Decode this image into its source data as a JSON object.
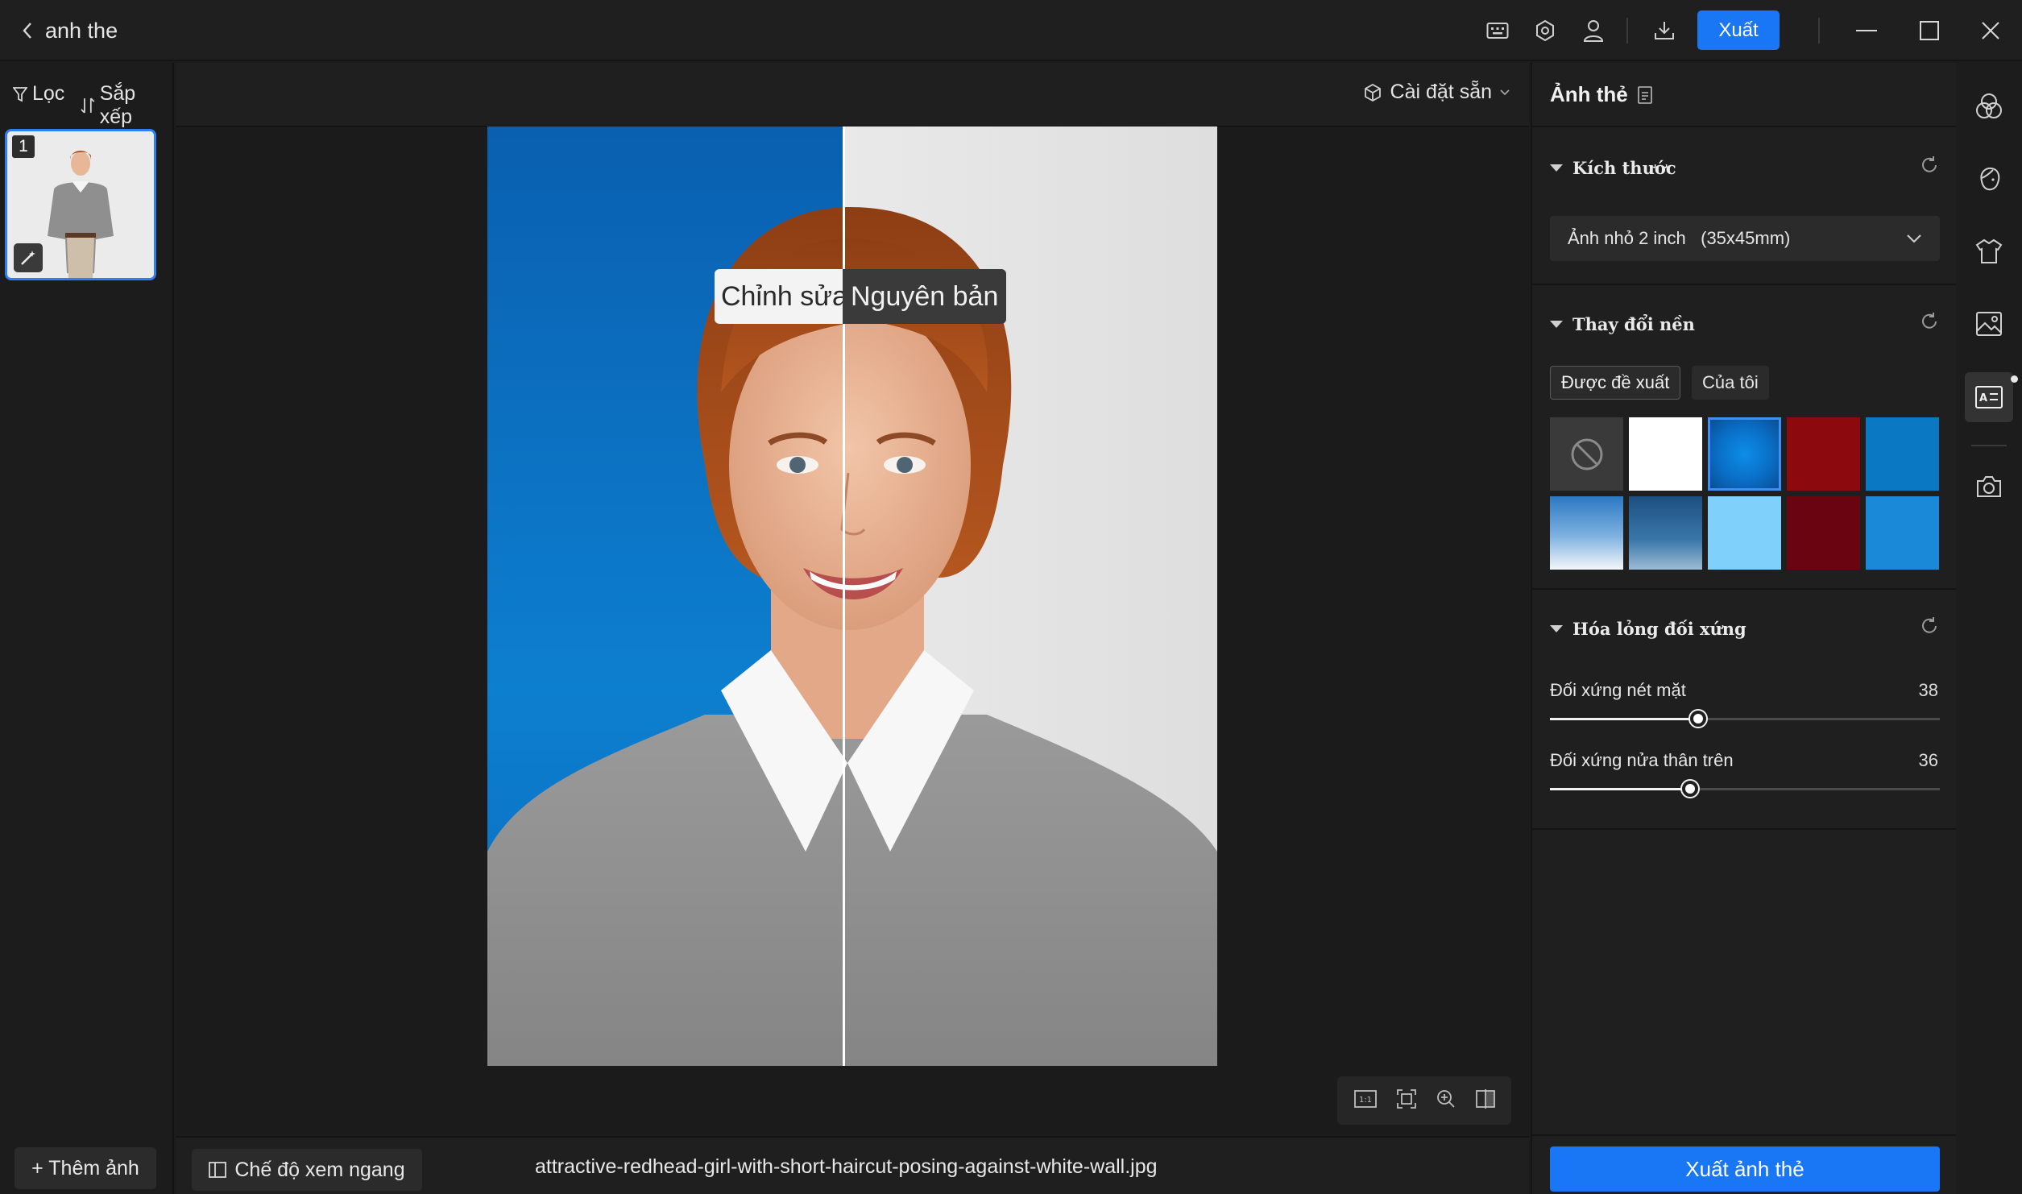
{
  "title_bar": {
    "back_label": "anh the",
    "export_label": "Xuất",
    "icons": [
      "keyboard-icon",
      "settings-icon",
      "user-icon",
      "download-icon",
      "minimize-icon",
      "maximize-icon",
      "close-icon"
    ]
  },
  "left_panel": {
    "filter_label": "Lọc",
    "sort_label": "Sắp xếp",
    "thumbnail_number": "1",
    "add_photo_label": "+ Thêm ảnh"
  },
  "center": {
    "preset_label": "Cài đặt sẵn",
    "compare_edited": "Chỉnh sửa",
    "compare_original": "Nguyên bản",
    "view_mode_label": "Chế độ xem ngang",
    "filename": "attractive-redhead-girl-with-short-haircut-posing-against-white-wall.jpg",
    "zoom_tools": [
      "actual-size-icon",
      "fit-screen-icon",
      "zoom-in-icon",
      "compare-split-icon"
    ]
  },
  "right_panel": {
    "title": "Ảnh thẻ",
    "size_section": {
      "heading": "Kích thước",
      "selected_size": "Ảnh nhỏ 2 inch   (35x45mm)"
    },
    "background_section": {
      "heading": "Thay đổi nền",
      "tab_recommended": "Được đề xuất",
      "tab_mine": "Của tôi",
      "selected_index": 2,
      "swatches": [
        {
          "name": "none",
          "color": "#3a3a3a"
        },
        {
          "name": "white",
          "color": "#ffffff"
        },
        {
          "name": "blue-radial",
          "color": "#0a7fd6"
        },
        {
          "name": "red",
          "color": "#8c0a0e"
        },
        {
          "name": "blue",
          "color": "#0b78c4"
        },
        {
          "name": "sky-gradient",
          "color": "#5a9fd6"
        },
        {
          "name": "steel-gradient",
          "color": "#2f6d9e"
        },
        {
          "name": "light-blue",
          "color": "#7fd0fb"
        },
        {
          "name": "dark-red",
          "color": "#6a0410"
        },
        {
          "name": "bright-blue",
          "color": "#1a8ad8"
        }
      ]
    },
    "symmetry_section": {
      "heading": "Hóa lỏng đối xứng",
      "sliders": [
        {
          "label": "Đối xứng nét mặt",
          "value": "38",
          "fraction": 0.38
        },
        {
          "label": "Đối xứng nửa thân trên",
          "value": "36",
          "fraction": 0.36
        }
      ]
    },
    "export_label": "Xuất ảnh thẻ"
  },
  "tool_rail": [
    "color-circles-icon",
    "face-icon",
    "shirt-icon",
    "image-icon",
    "id-card-icon",
    "camera-icon"
  ],
  "colors": {
    "accent": "#1976f5",
    "panel_bg": "#1f1f1f",
    "canvas_bg": "#1b1b1b"
  }
}
